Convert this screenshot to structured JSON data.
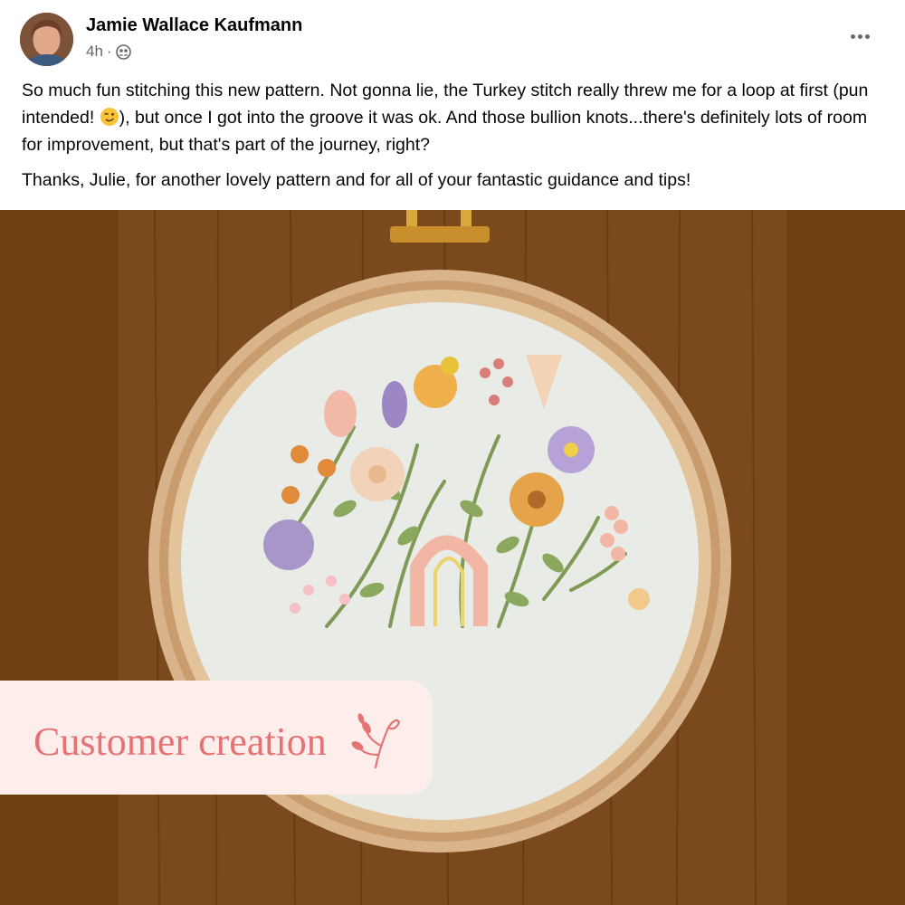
{
  "post": {
    "author": "Jamie Wallace Kaufmann",
    "timestamp": "4h",
    "separator": "·",
    "audience_icon": "friends-icon",
    "more_icon": "more-options-icon",
    "paragraph1_part1": "So much fun stitching this new pattern. Not gonna lie, the Turkey stitch really threw me for a loop at first (pun intended! ",
    "wink_emoji": "winking-face-emoji",
    "paragraph1_part2": "), but once I got into the groove it was ok. And those bullion knots...there's definitely lots of room for improvement, but that's part of the journey, right?",
    "paragraph2": "Thanks, Julie, for another lovely pattern and for all of your fantastic guidance and tips!"
  },
  "overlay": {
    "label": "Customer creation",
    "icon": "sprig-icon",
    "text_color": "#e57373",
    "background": "#fdeeec"
  },
  "colors": {
    "wood_bg": "#6f3f0f",
    "fabric": "#e8ebe6",
    "hoop": "#d9b48a"
  }
}
